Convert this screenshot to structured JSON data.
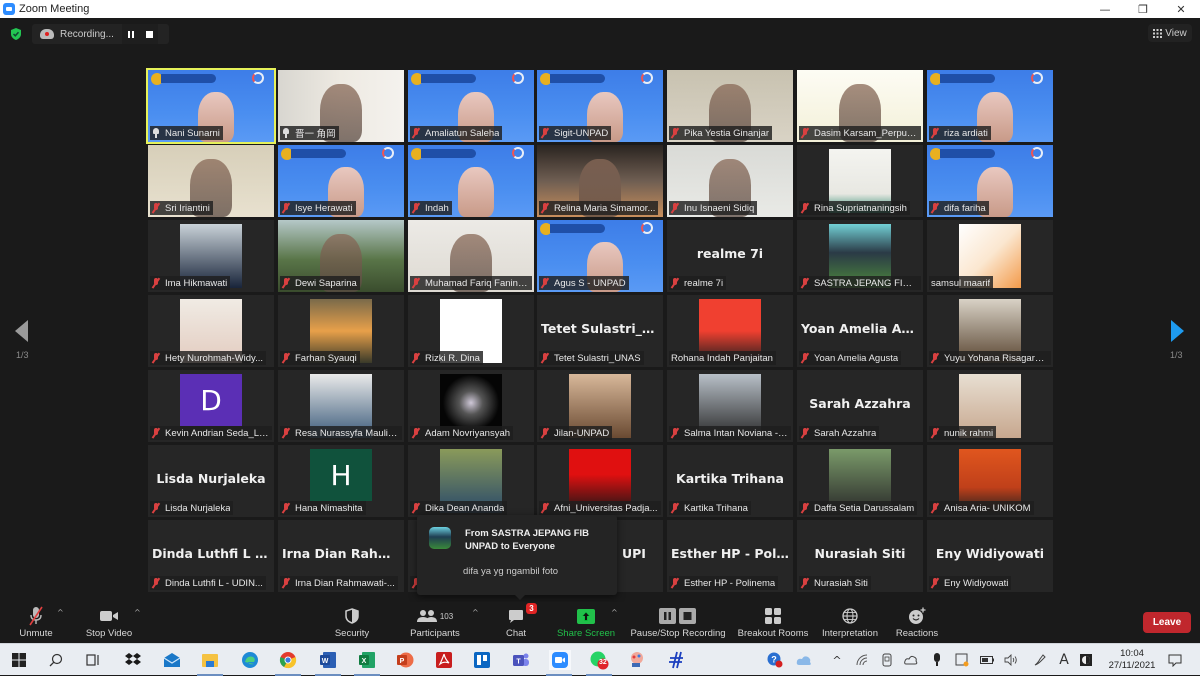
{
  "window": {
    "title": "Zoom Meeting",
    "controls": [
      "minimize",
      "maximize",
      "close"
    ]
  },
  "topbar": {
    "recording_label": "Recording...",
    "view_label": "View"
  },
  "navigation": {
    "page_left": "1/3",
    "page_right": "1/3"
  },
  "tiles": [
    {
      "name": "Nani Sunarni",
      "type": "banner",
      "icon": "pin",
      "active": true
    },
    {
      "name": "晋一 角岡",
      "type": "video",
      "icon": "pin"
    },
    {
      "name": "Amaliatun Saleha",
      "type": "banner",
      "icon": "mic-off"
    },
    {
      "name": "Sigit-UNPAD",
      "type": "banner",
      "icon": "mic-off"
    },
    {
      "name": "Pika Yestia Ginanjar",
      "type": "video",
      "icon": "mic-off"
    },
    {
      "name": "Dasim Karsam_Perpust...",
      "type": "video",
      "icon": "mic-off"
    },
    {
      "name": "riza ardiati",
      "type": "banner",
      "icon": "mic-off"
    },
    {
      "name": "Sri Iriantini",
      "type": "video",
      "icon": "mic-off"
    },
    {
      "name": "Isye Herawati",
      "type": "banner",
      "icon": "mic-off"
    },
    {
      "name": "Indah",
      "type": "banner",
      "icon": "mic-off"
    },
    {
      "name": "Relina Maria Simamor...",
      "type": "video",
      "icon": "mic-off"
    },
    {
      "name": "Inu Isnaeni Sidiq",
      "type": "video",
      "icon": "mic-off"
    },
    {
      "name": "Rina Supriatnaningsih",
      "type": "photo",
      "icon": "mic-off"
    },
    {
      "name": "difa fariha",
      "type": "banner",
      "icon": "mic-off"
    },
    {
      "name": "Ima Hikmawati",
      "type": "photo",
      "icon": "mic-off"
    },
    {
      "name": "Dewi Saparina",
      "type": "video",
      "icon": "mic-off"
    },
    {
      "name": "Muhamad Fariq Fanind...",
      "type": "video",
      "icon": "mic-off"
    },
    {
      "name": "Agus S - UNPAD",
      "type": "banner",
      "icon": "mic-off"
    },
    {
      "name": "realme 7i",
      "type": "text",
      "display": "realme 7i",
      "icon": "mic-off"
    },
    {
      "name": "SASTRA JEPANG FIB U...",
      "type": "photo",
      "icon": "mic-off"
    },
    {
      "name": "samsul maarif",
      "type": "photo",
      "icon": "none"
    },
    {
      "name": "Hety Nurohmah-Widy...",
      "type": "photo",
      "icon": "mic-off"
    },
    {
      "name": "Farhan Syauqi",
      "type": "photo",
      "icon": "mic-off"
    },
    {
      "name": "Rizki R. Dina",
      "type": "photo",
      "icon": "mic-off"
    },
    {
      "name": "Tetet Sulastri_UNAS",
      "type": "text",
      "display": "Tetet  Sulastri_U...",
      "icon": "mic-off"
    },
    {
      "name": "Rohana Indah Panjaitan",
      "type": "photo",
      "icon": "none"
    },
    {
      "name": "Yoan Amelia Agusta",
      "type": "text",
      "display": "Yoan  Amelia  Ag...",
      "icon": "mic-off"
    },
    {
      "name": "Yuyu Yohana Risagarni...",
      "type": "photo",
      "icon": "mic-off"
    },
    {
      "name": "Kevin Andrian Seda_Li...",
      "type": "letter",
      "letter": "D",
      "icon": "mic-off"
    },
    {
      "name": "Resa Nurassyfa Maulin...",
      "type": "photo",
      "icon": "mic-off"
    },
    {
      "name": "Adam Novriyansyah",
      "type": "photo",
      "icon": "mic-off"
    },
    {
      "name": "Jilan-UNPAD",
      "type": "photo",
      "icon": "mic-off"
    },
    {
      "name": "Salma Intan Noviana - ...",
      "type": "photo",
      "icon": "mic-off"
    },
    {
      "name": "Sarah Azzahra",
      "type": "text",
      "display": "Sarah Azzahra",
      "icon": "mic-off"
    },
    {
      "name": "nunik rahmi",
      "type": "photo",
      "icon": "mic-off"
    },
    {
      "name": "Lisda Nurjaleka",
      "type": "text",
      "display": "Lisda Nurjaleka",
      "icon": "mic-off"
    },
    {
      "name": "Hana Nimashita",
      "type": "letter",
      "letter": "H",
      "icon": "mic-off"
    },
    {
      "name": "Dika Dean Ananda",
      "type": "photo",
      "icon": "mic-off"
    },
    {
      "name": "Afni_Universitas Padja...",
      "type": "photo",
      "icon": "mic-off"
    },
    {
      "name": "Kartika Trihana",
      "type": "text",
      "display": "Kartika Trihana",
      "icon": "mic-off"
    },
    {
      "name": "Daffa Setia Darussalam",
      "type": "photo",
      "icon": "mic-off"
    },
    {
      "name": "Anisa Aria- UNIKOM",
      "type": "photo",
      "icon": "mic-off"
    },
    {
      "name": "Dinda Luthfi L - UDIN...",
      "type": "text",
      "display": "Dinda  Luthfi  L  -...",
      "icon": "mic-off"
    },
    {
      "name": "Irna Dian Rahmawati-...",
      "type": "text",
      "display": "Irna  Dian  Rahm...",
      "icon": "mic-off"
    },
    {
      "name": "",
      "type": "text",
      "display": "",
      "icon": "mic-off",
      "hidden_by_popup": true
    },
    {
      "name": "",
      "type": "text",
      "display": "UPI",
      "icon": "none"
    },
    {
      "name": "Esther HP - Polinema",
      "type": "text",
      "display": "Esther  HP  -  Poli...",
      "icon": "mic-off"
    },
    {
      "name": "Nurasiah Siti",
      "type": "text",
      "display": "Nurasiah Siti",
      "icon": "mic-off"
    },
    {
      "name": "Eny Widiyowati",
      "type": "text",
      "display": "Eny Widiyowati",
      "icon": "mic-off"
    }
  ],
  "chat_popup": {
    "from": "From SASTRA JEPANG FIB UNPAD to Everyone",
    "message": "difa ya yg ngambil foto"
  },
  "toolbar": {
    "unmute": "Unmute",
    "stop_video": "Stop Video",
    "security": "Security",
    "participants": "Participants",
    "participants_count": "103",
    "chat": "Chat",
    "chat_badge": "3",
    "share_screen": "Share Screen",
    "recording": "Pause/Stop Recording",
    "breakout": "Breakout Rooms",
    "interpretation": "Interpretation",
    "reactions": "Reactions",
    "leave": "Leave"
  },
  "taskbar": {
    "apps": [
      "start",
      "search",
      "task-view",
      "dropbox",
      "mail",
      "file-explorer",
      "edge",
      "chrome",
      "word",
      "excel",
      "powerpoint",
      "acrobat",
      "trello",
      "teams",
      "zoom",
      "whatsapp",
      "paint",
      "onenote-alt"
    ],
    "whatsapp_badge": "32",
    "time": "10:04",
    "date": "27/11/2021"
  },
  "colors": {
    "accent_blue": "#1e9bf0",
    "active_speaker": "#e6f25a",
    "leave_red": "#c0272d",
    "share_green": "#21c04a",
    "muted_red": "#d94040"
  }
}
